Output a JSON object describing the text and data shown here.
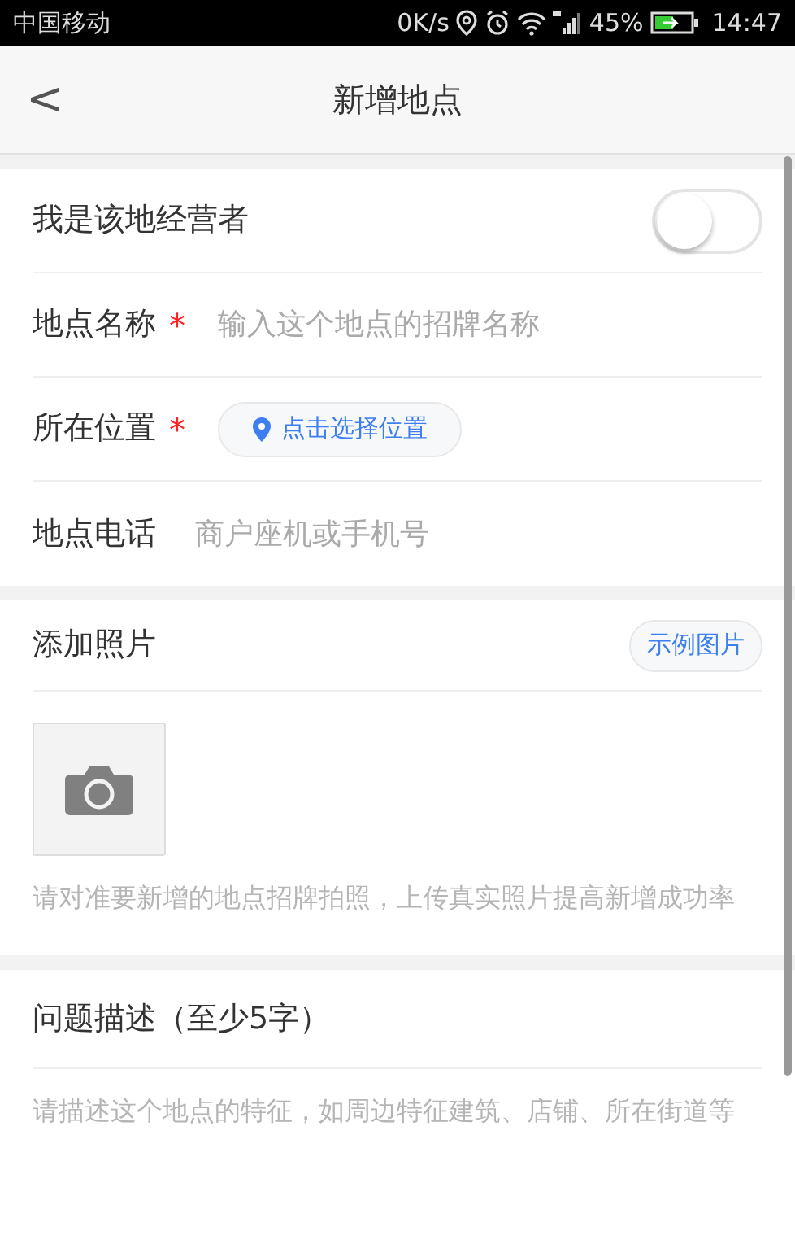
{
  "status_bar": {
    "carrier": "中国移动",
    "speed": "0K/s",
    "battery": "45%",
    "time": "14:47"
  },
  "header": {
    "back": "<",
    "title": "新增地点"
  },
  "fields": [
    {
      "kind": "toggle",
      "label": "我是该地经营者",
      "on": false
    },
    {
      "kind": "input",
      "label": "地点名称",
      "required_mark": "*",
      "placeholder": "输入这个地点的招牌名称"
    },
    {
      "kind": "location",
      "label": "所在位置",
      "required_mark": "*",
      "button": "点击选择位置"
    },
    {
      "kind": "input",
      "label": "地点电话",
      "placeholder": "商户座机或手机号"
    }
  ],
  "photos": {
    "title": "添加照片",
    "example_button": "示例图片",
    "hint": "请对准要新增的地点招牌拍照，上传真实照片提高新增成功率"
  },
  "description": {
    "title": "问题描述（至少5字）",
    "placeholder": "请描述这个地点的特征，如周边特征建筑、店铺、所在街道等"
  }
}
